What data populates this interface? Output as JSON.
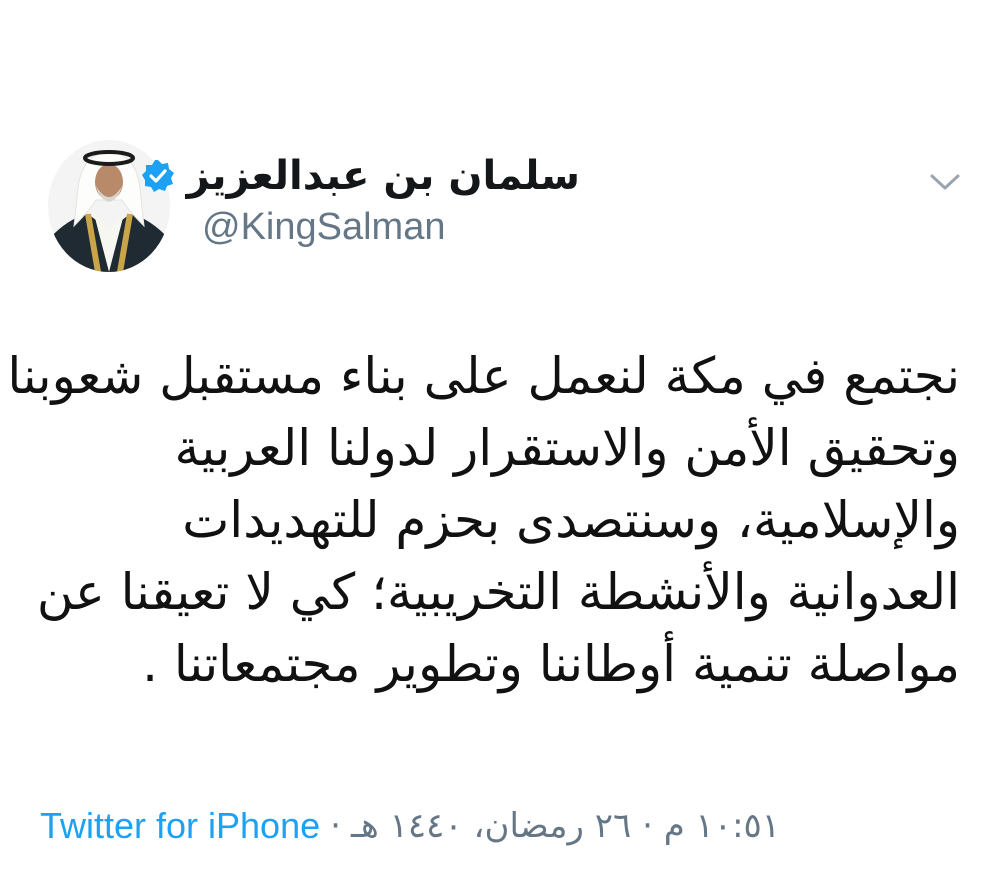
{
  "tweet": {
    "display_name": "سلمان بن عبدالعزيز",
    "handle": "@KingSalman",
    "verified_icon": "verified-badge-icon",
    "menu_icon": "chevron-down-icon",
    "avatar_icon": "avatar",
    "body_lines": [
      "نجتمع في مكة لنعمل على بناء مستقبل شعوبنا ،",
      "وتحقيق الأمن والاستقرار لدولنا العربية",
      "والإسلامية، وسنتصدى بحزم للتهديدات",
      "العدوانية والأنشطة التخريبية؛ كي لا تعيقنا عن",
      "مواصلة تنمية أوطاننا وتطوير مجتمعاتنا ."
    ],
    "timestamp": "١٠:٥١ م · ٢٦ رمضان، ١٤٤٠ هـ",
    "separator": "·",
    "source": "Twitter for iPhone"
  },
  "colors": {
    "verified_blue": "#1da1f2",
    "link_blue": "#1da1f2",
    "meta_gray": "#657786",
    "text_black": "#14171a"
  }
}
